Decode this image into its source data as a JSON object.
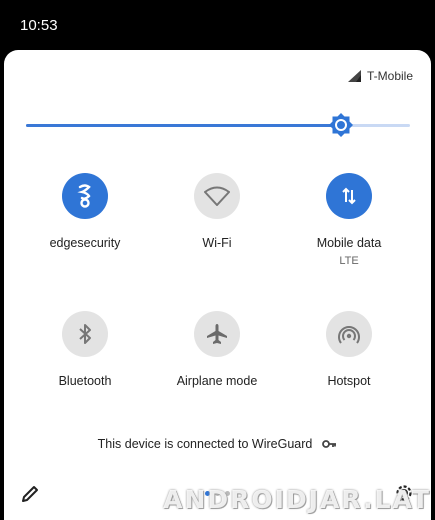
{
  "status_bar": {
    "time": "10:53"
  },
  "header": {
    "carrier": "T-Mobile",
    "signal_icon": "signal-icon"
  },
  "brightness": {
    "level": 0.82,
    "thumb_icon": "brightness-icon"
  },
  "tiles": [
    {
      "label": "edgesecurity",
      "sub": "",
      "state": "on",
      "icon": "vpn-key-icon"
    },
    {
      "label": "Wi-Fi",
      "sub": "",
      "state": "off",
      "icon": "wifi-icon"
    },
    {
      "label": "Mobile data",
      "sub": "LTE",
      "state": "on",
      "icon": "mobile-data-icon"
    },
    {
      "label": "Bluetooth",
      "sub": "",
      "state": "off",
      "icon": "bluetooth-icon"
    },
    {
      "label": "Airplane mode",
      "sub": "",
      "state": "off",
      "icon": "airplane-icon"
    },
    {
      "label": "Hotspot",
      "sub": "",
      "state": "off",
      "icon": "hotspot-icon"
    }
  ],
  "vpn_note": {
    "text": "This device is connected to WireGuard",
    "icon": "key-icon"
  },
  "footer": {
    "edit_icon": "pencil-icon",
    "settings_icon": "gear-icon",
    "pages": 3,
    "active_page": 1
  },
  "watermark": "ANDROIDJAR.LAT",
  "colors": {
    "accent": "#2f75d6",
    "tile_off": "#e3e3e3",
    "panel": "#ffffff",
    "background": "#000000"
  }
}
